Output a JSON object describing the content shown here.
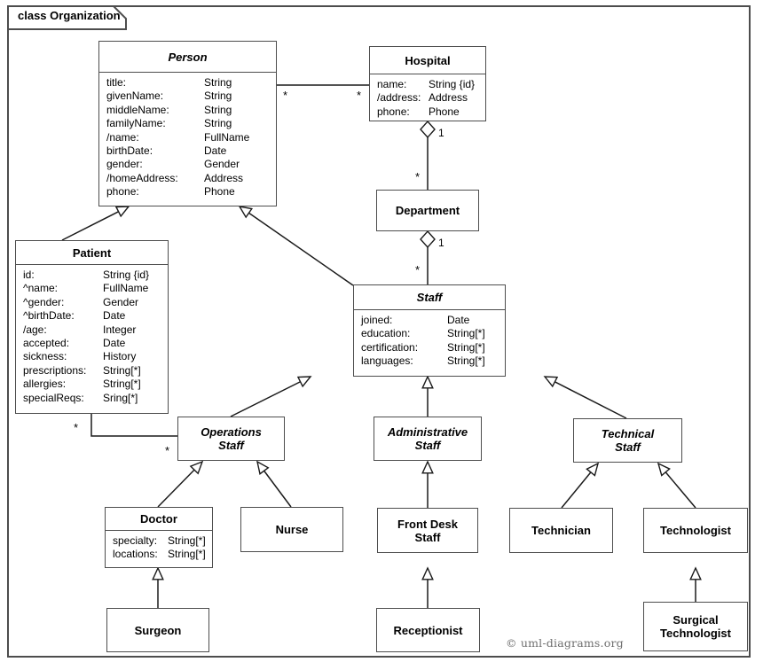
{
  "frame": {
    "label": "class Organization"
  },
  "copyright": "© uml-diagrams.org",
  "classes": {
    "person": {
      "name": "Person",
      "attrs": [
        {
          "name": "title:",
          "type": "String"
        },
        {
          "name": "givenName:",
          "type": "String"
        },
        {
          "name": "middleName:",
          "type": "String"
        },
        {
          "name": "familyName:",
          "type": "String"
        },
        {
          "name": "/name:",
          "type": "FullName"
        },
        {
          "name": "birthDate:",
          "type": "Date"
        },
        {
          "name": "gender:",
          "type": "Gender"
        },
        {
          "name": "/homeAddress:",
          "type": "Address"
        },
        {
          "name": "phone:",
          "type": "Phone"
        }
      ]
    },
    "hospital": {
      "name": "Hospital",
      "attrs": [
        {
          "name": "name:",
          "type": "String {id}"
        },
        {
          "name": "/address:",
          "type": "Address"
        },
        {
          "name": "phone:",
          "type": "Phone"
        }
      ]
    },
    "patient": {
      "name": "Patient",
      "attrs": [
        {
          "name": "id:",
          "type": "String {id}"
        },
        {
          "name": "^name:",
          "type": "FullName"
        },
        {
          "name": "^gender:",
          "type": "Gender"
        },
        {
          "name": "^birthDate:",
          "type": "Date"
        },
        {
          "name": "/age:",
          "type": "Integer"
        },
        {
          "name": "accepted:",
          "type": "Date"
        },
        {
          "name": "sickness:",
          "type": "History"
        },
        {
          "name": "prescriptions:",
          "type": "String[*]"
        },
        {
          "name": "allergies:",
          "type": "String[*]"
        },
        {
          "name": "specialReqs:",
          "type": "Sring[*]"
        }
      ]
    },
    "department": {
      "name": "Department"
    },
    "staff": {
      "name": "Staff",
      "attrs": [
        {
          "name": "joined:",
          "type": "Date"
        },
        {
          "name": "education:",
          "type": "String[*]"
        },
        {
          "name": "certification:",
          "type": "String[*]"
        },
        {
          "name": "languages:",
          "type": "String[*]"
        }
      ]
    },
    "operations_staff": {
      "name": "Operations\nStaff",
      "line1": "Operations",
      "line2": "Staff"
    },
    "administrative_staff": {
      "name": "Administrative\nStaff",
      "line1": "Administrative",
      "line2": "Staff"
    },
    "technical_staff": {
      "name": "Technical\nStaff",
      "line1": "Technical",
      "line2": "Staff"
    },
    "doctor": {
      "name": "Doctor",
      "attrs": [
        {
          "name": "specialty:",
          "type": "String[*]"
        },
        {
          "name": "locations:",
          "type": "String[*]"
        }
      ]
    },
    "nurse": {
      "name": "Nurse"
    },
    "front_desk_staff": {
      "line1": "Front Desk",
      "line2": "Staff"
    },
    "technician": {
      "name": "Technician"
    },
    "technologist": {
      "name": "Technologist"
    },
    "surgeon": {
      "name": "Surgeon"
    },
    "receptionist": {
      "name": "Receptionist"
    },
    "surgical_technologist": {
      "line1": "Surgical",
      "line2": "Technologist"
    }
  },
  "multiplicities": {
    "person_hospital_left": "*",
    "person_hospital_right": "*",
    "hospital_department_1": "1",
    "hospital_department_star": "*",
    "department_staff_1": "1",
    "department_staff_star": "*",
    "patient_ops_left": "*",
    "patient_ops_right": "*"
  }
}
